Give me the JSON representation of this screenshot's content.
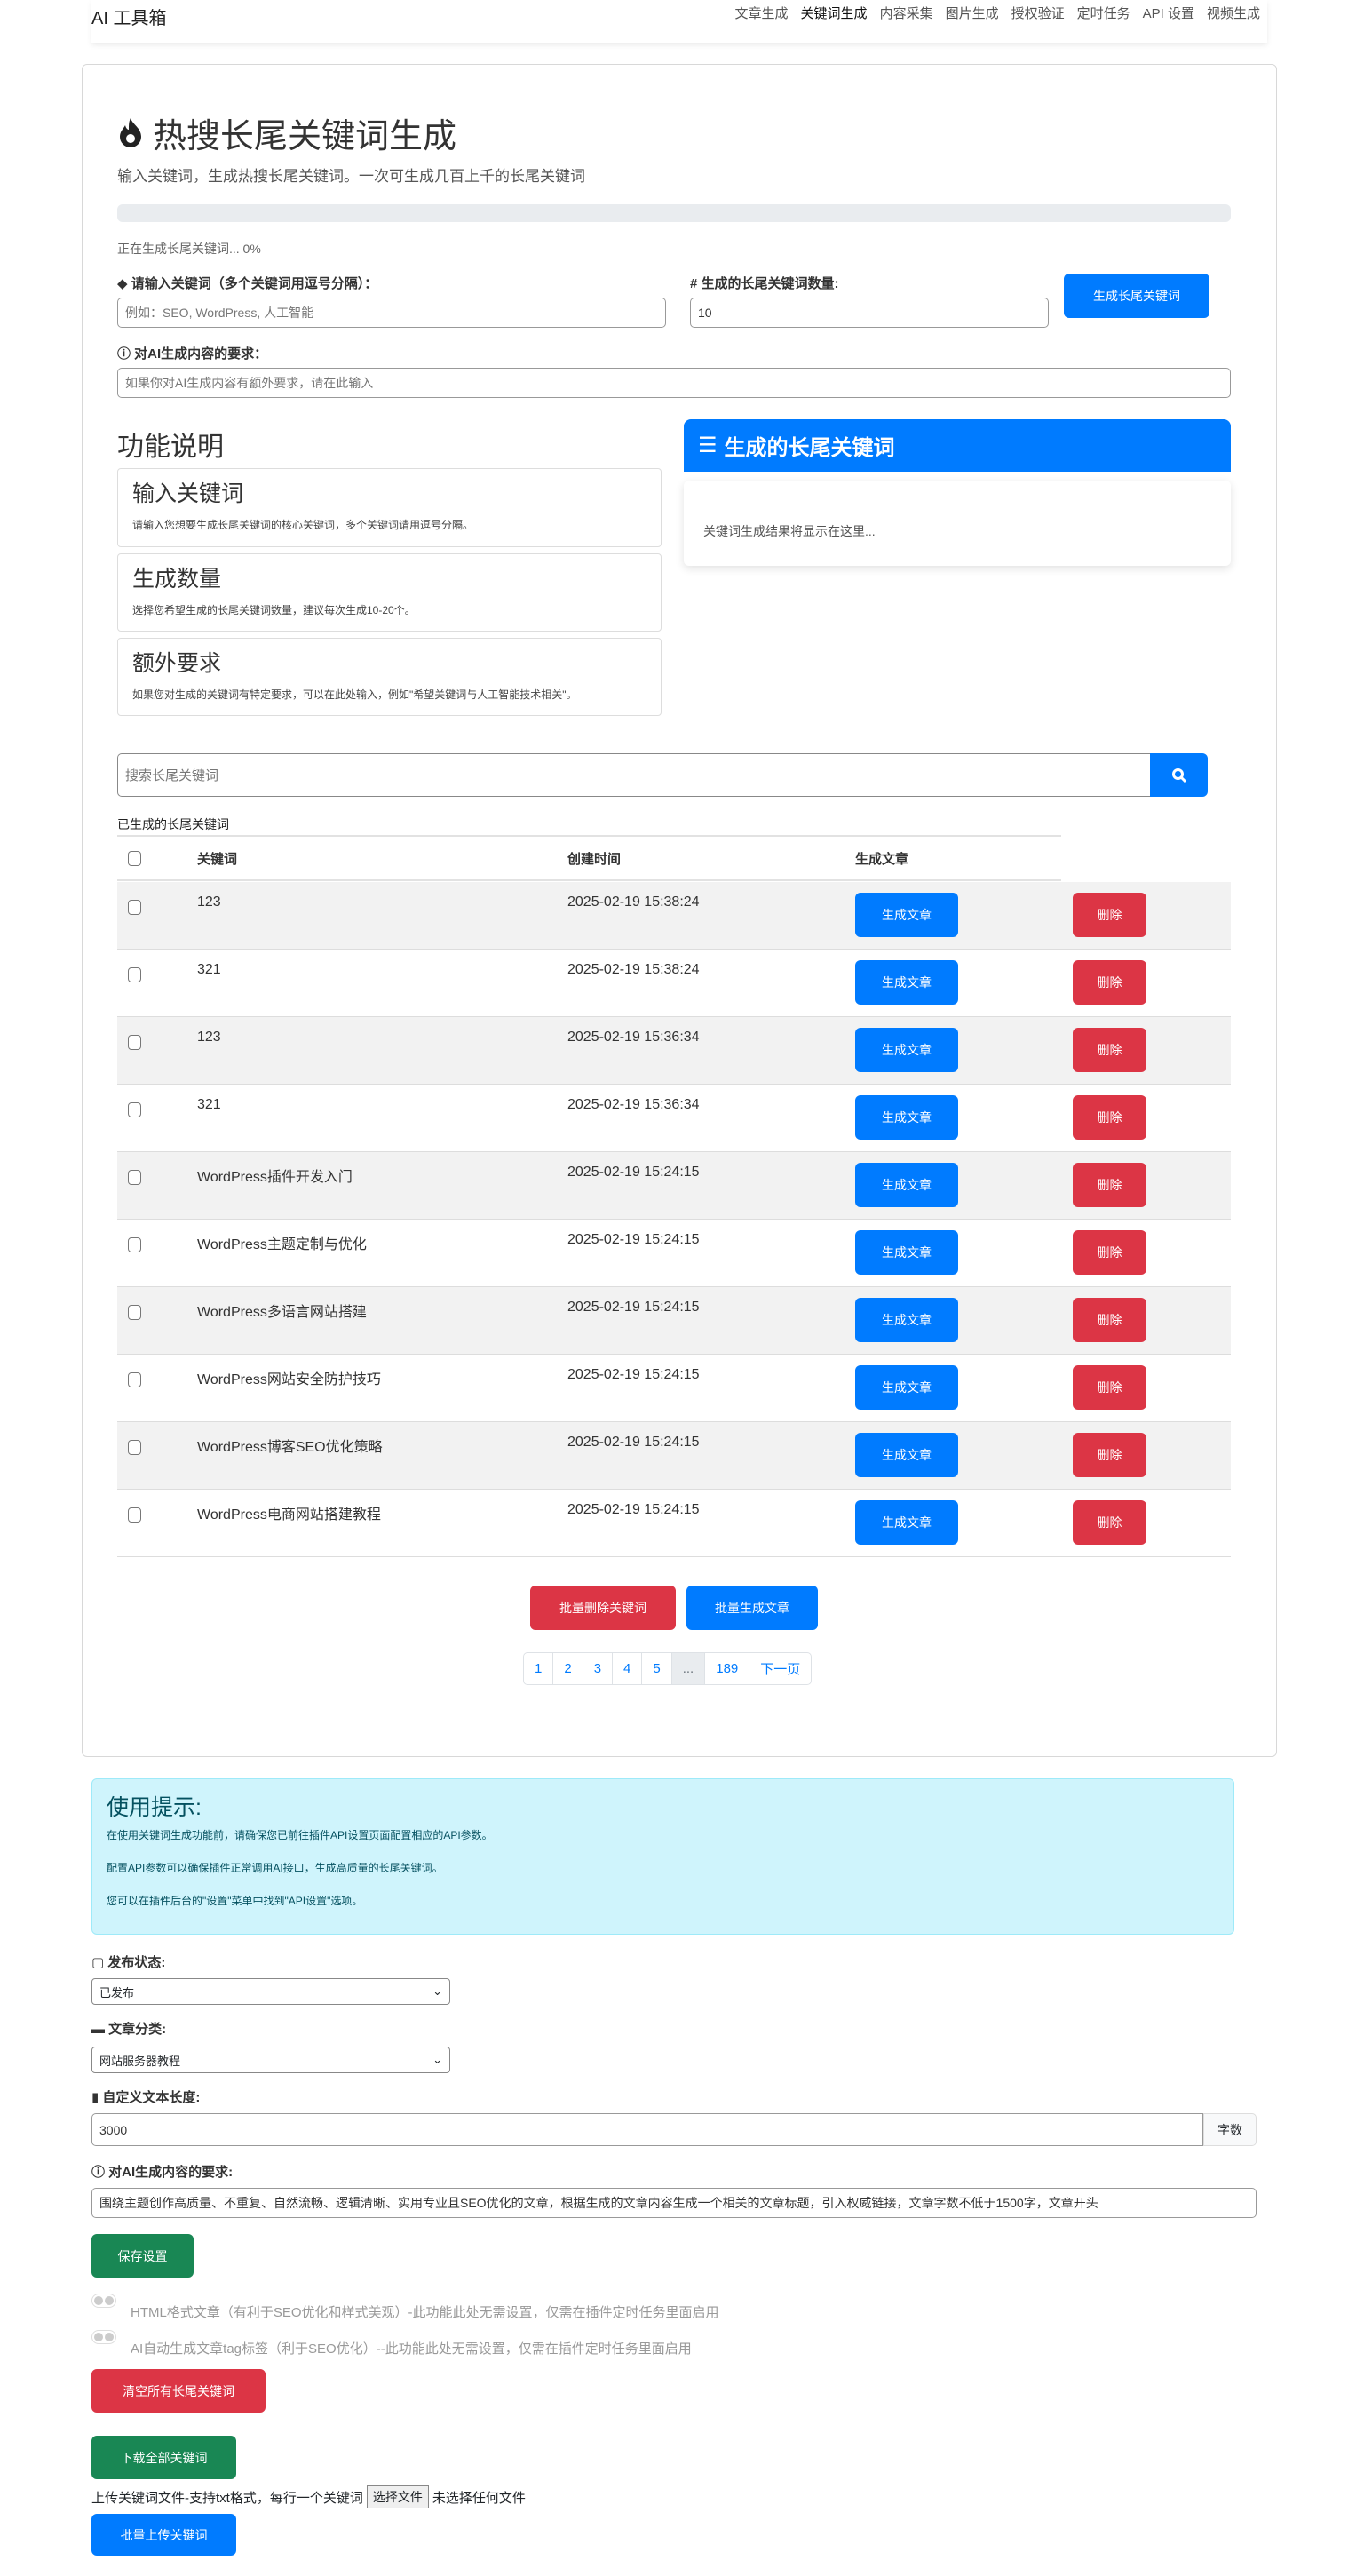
{
  "navbar": {
    "brand": "AI 工具箱",
    "items": [
      "文章生成",
      "关键词生成",
      "内容采集",
      "图片生成",
      "授权验证",
      "定时任务",
      "API 设置",
      "视频生成"
    ],
    "active": 1
  },
  "header": {
    "title": "热搜长尾关键词生成",
    "subtitle": "输入关键词，生成热搜长尾关键词。一次可生成几百上千的长尾关键词"
  },
  "progress": {
    "percent": 0,
    "status": "正在生成长尾关键词... 0%"
  },
  "form": {
    "keyword_label": "请输入关键词（多个关键词用逗号分隔）：",
    "keyword_placeholder": "例如：SEO, WordPress, 人工智能",
    "count_label": "# 生成的长尾关键词数量:",
    "count_value": "10",
    "generate_button": "生成长尾关键词",
    "ai_label": "对AI生成内容的要求：",
    "ai_placeholder": "如果你对AI生成内容有额外要求，请在此输入"
  },
  "features": {
    "title": "功能说明",
    "items": [
      {
        "title": "输入关键词",
        "desc": "请输入您想要生成长尾关键词的核心关键词，多个关键词请用逗号分隔。"
      },
      {
        "title": "生成数量",
        "desc": "选择您希望生成的长尾关键词数量，建议每次生成10-20个。"
      },
      {
        "title": "额外要求",
        "desc": "如果您对生成的关键词有特定要求，可以在此处输入，例如\"希望关键词与人工智能技术相关\"。"
      }
    ]
  },
  "results": {
    "title": "生成的长尾关键词",
    "placeholder": "关键词生成结果将显示在这里..."
  },
  "search": {
    "placeholder": "搜索长尾关键词"
  },
  "table": {
    "caption": "已生成的长尾关键词",
    "headers": [
      "关键词",
      "创建时间",
      "生成文章"
    ],
    "gen_label": "生成文章",
    "del_label": "删除",
    "rows": [
      [
        "123",
        "2025-02-19 15:38:24"
      ],
      [
        "321",
        "2025-02-19 15:38:24"
      ],
      [
        "123",
        "2025-02-19 15:36:34"
      ],
      [
        "321",
        "2025-02-19 15:36:34"
      ],
      [
        "WordPress插件开发入门",
        "2025-02-19 15:24:15"
      ],
      [
        "WordPress主题定制与优化",
        "2025-02-19 15:24:15"
      ],
      [
        "WordPress多语言网站搭建",
        "2025-02-19 15:24:15"
      ],
      [
        "WordPress网站安全防护技巧",
        "2025-02-19 15:24:15"
      ],
      [
        "WordPress博客SEO优化策略",
        "2025-02-19 15:24:15"
      ],
      [
        "WordPress电商网站搭建教程",
        "2025-02-19 15:24:15"
      ]
    ]
  },
  "bulk": {
    "delete": "批量删除关键词",
    "generate": "批量生成文章"
  },
  "pagination": [
    "1",
    "2",
    "3",
    "4",
    "5",
    "...",
    "189",
    "下一页"
  ],
  "tips": {
    "title": "使用提示:",
    "lines": [
      "在使用关键词生成功能前，请确保您已前往插件API设置页面配置相应的API参数。",
      "配置API参数可以确保插件正常调用AI接口，生成高质量的长尾关键词。",
      "您可以在插件后台的\"设置\"菜单中找到\"API设置\"选项。"
    ]
  },
  "settings": {
    "status_label": "发布状态:",
    "status_value": "已发布",
    "category_label": "文章分类:",
    "category_value": "网站服务器教程",
    "length_label": "自定义文本长度:",
    "length_value": "3000",
    "length_unit": "字数",
    "ai_label": "对AI生成内容的要求:",
    "ai_value": "围绕主题创作高质量、不重复、自然流畅、逻辑清晰、实用专业且SEO优化的文章，根据生成的文章内容生成一个相关的文章标题，引入权威链接，文章字数不低于1500字，文章开头",
    "save": "保存设置",
    "toggle_html": "HTML格式文章（有利于SEO优化和样式美观）-此功能此处无需设置，仅需在插件定时任务里面启用",
    "toggle_tag": "AI自动生成文章tag标签（利于SEO优化）--此功能此处无需设置，仅需在插件定时任务里面启用",
    "clear": "清空所有长尾关键词",
    "download": "下载全部关键词",
    "upload_text": "上传关键词文件-支持txt格式，每行一个关键词",
    "choose_file": "选择文件",
    "no_file": "未选择任何文件",
    "batch_upload": "批量上传关键词"
  },
  "colors": {
    "primary": "#007bff",
    "danger": "#dc3545",
    "success": "#198754",
    "info_bg": "#cff4fc"
  }
}
